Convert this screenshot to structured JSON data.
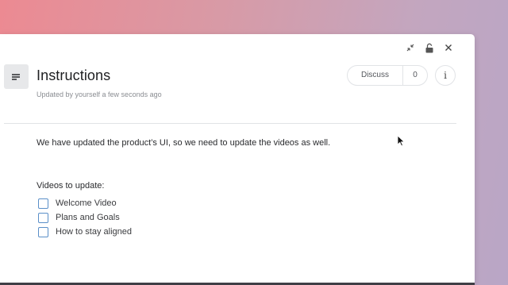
{
  "window_controls": {
    "collapse_icon": "collapse-arrows-icon",
    "lock_icon": "unlock-icon",
    "close_icon": "close-icon"
  },
  "header": {
    "title": "Instructions",
    "subtitle": "Updated by yourself a few seconds ago",
    "discuss_label": "Discuss",
    "discuss_count": "0",
    "info_label": "i"
  },
  "content": {
    "body": "We have updated the product’s UI, so we need to update the videos as well.",
    "list_heading": "Videos to update:",
    "items": [
      {
        "label": "Welcome Video",
        "checked": false
      },
      {
        "label": "Plans and Goals",
        "checked": false
      },
      {
        "label": "How to stay aligned",
        "checked": false
      }
    ]
  }
}
